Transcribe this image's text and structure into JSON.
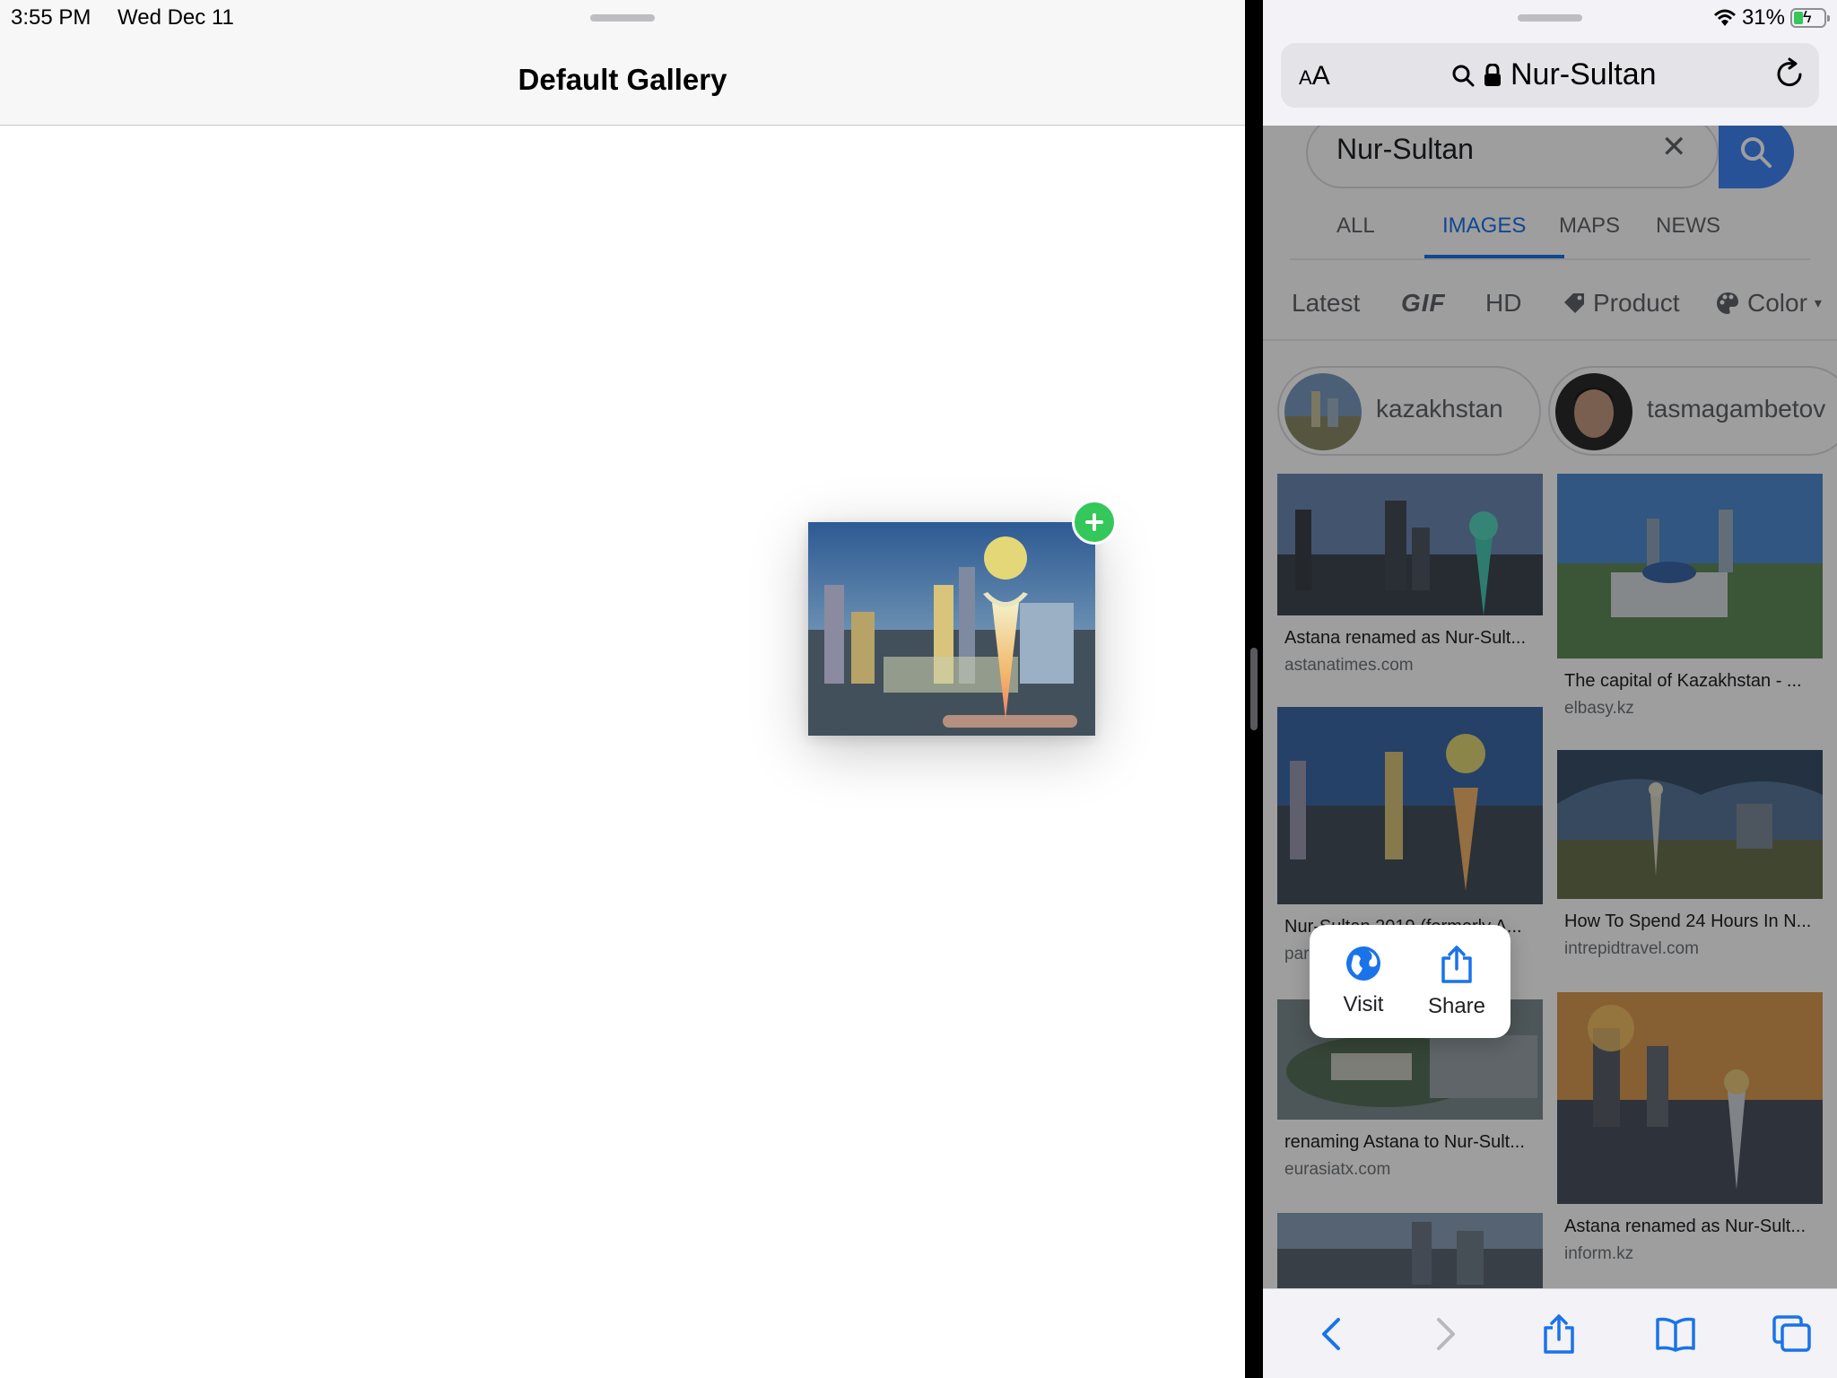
{
  "status_bar": {
    "time": "3:55 PM",
    "date": "Wed Dec 11",
    "battery_percent": "31%",
    "battery_level": 0.31
  },
  "left_app": {
    "title": "Default Gallery"
  },
  "safari": {
    "text_size_label_small": "A",
    "text_size_label_large": "A",
    "url": "Nur-Sultan",
    "search_query": "Nur-Sultan",
    "tabs": [
      {
        "label": "ALL",
        "active": false
      },
      {
        "label": "IMAGES",
        "active": true
      },
      {
        "label": "MAPS",
        "active": false
      },
      {
        "label": "NEWS",
        "active": false
      }
    ],
    "filters": [
      "Latest",
      "GIF",
      "HD",
      "Product",
      "Color"
    ],
    "suggestions": [
      "kazakhstan",
      "tasmagambetov"
    ],
    "results": [
      {
        "title": "Astana renamed as Nur-Sult...",
        "source": "astanatimes.com"
      },
      {
        "title": "The capital of Kazakhstan - ...",
        "source": "elbasy.kz"
      },
      {
        "title": "Nur-Sultan 2019 (formerly A...",
        "source": "par..."
      },
      {
        "title": "How To Spend 24 Hours In N...",
        "source": "intrepidtravel.com"
      },
      {
        "title": "renaming Astana to Nur-Sult...",
        "source": "eurasiatx.com"
      },
      {
        "title": "Astana renamed as Nur-Sult...",
        "source": "inform.kz"
      }
    ],
    "popup": {
      "visit_label": "Visit",
      "share_label": "Share"
    }
  },
  "colors": {
    "accent": "#1a73e8",
    "search_button": "#4285f4",
    "add_badge": "#34c759"
  }
}
